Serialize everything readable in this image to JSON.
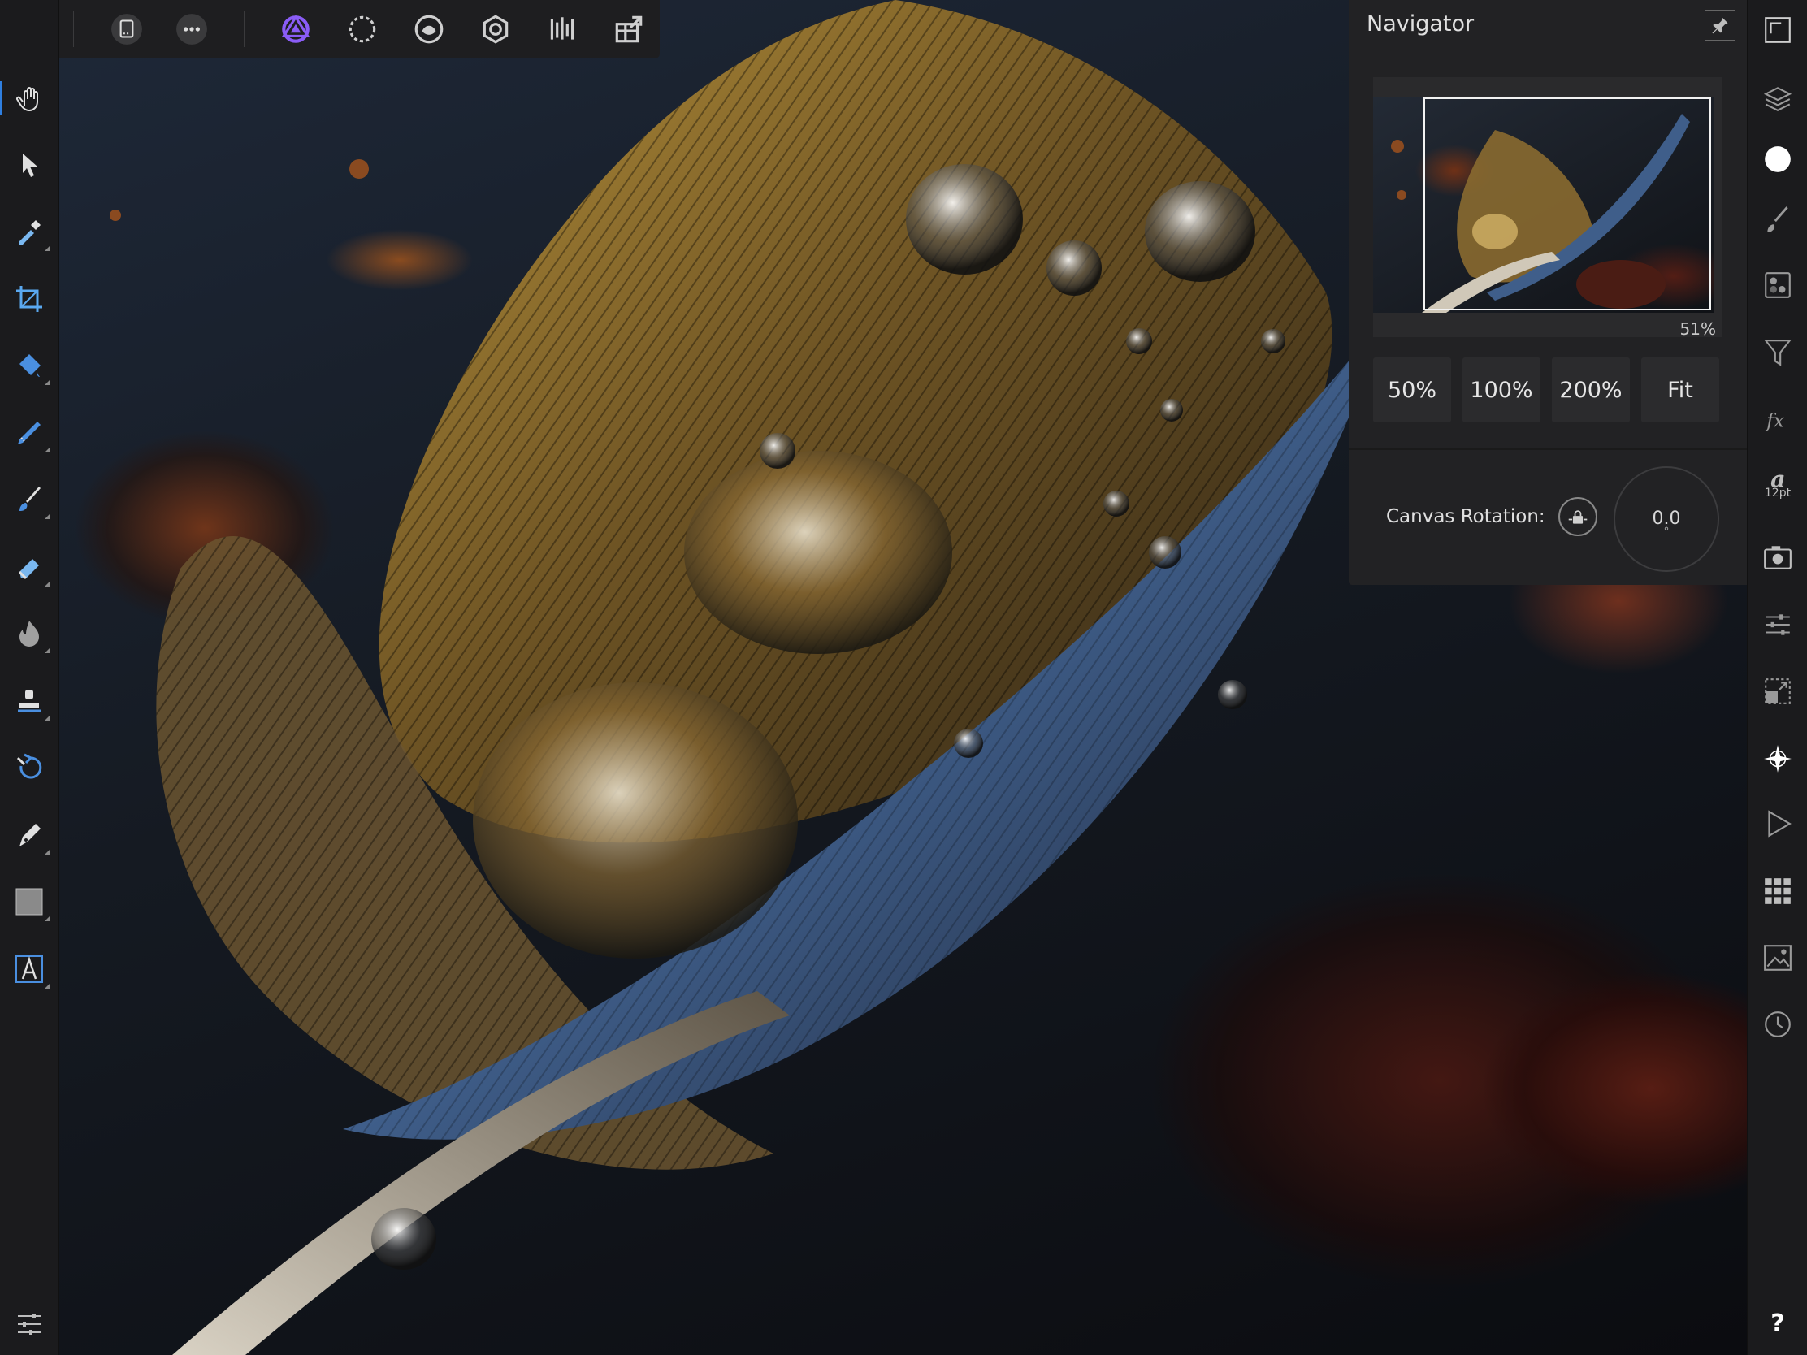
{
  "toolbar_top": {
    "buttons": [
      {
        "name": "back-icon"
      },
      {
        "name": "document-icon"
      },
      {
        "name": "more-icon"
      },
      {
        "name": "photo-persona-icon"
      },
      {
        "name": "selection-persona-icon"
      },
      {
        "name": "liquify-persona-icon"
      },
      {
        "name": "develop-persona-icon"
      },
      {
        "name": "tone-mapping-persona-icon"
      },
      {
        "name": "export-persona-icon"
      }
    ],
    "accent": "#8a5cf6"
  },
  "left_tools": [
    "view-tool",
    "move-tool",
    "color-picker-tool",
    "crop-tool",
    "flood-fill-tool",
    "selection-brush-tool",
    "paint-brush-tool",
    "erase-brush-tool",
    "dodge-tool",
    "clone-tool",
    "undo-brush-tool",
    "pen-tool",
    "shape-tool",
    "text-tool",
    "settings"
  ],
  "right_studio": {
    "items": [
      "fullscreen",
      "layers",
      "color",
      "brushes",
      "channels",
      "filters",
      "effects",
      "text-style",
      "snapshots",
      "adjustments",
      "transform",
      "navigator",
      "macro",
      "swatches",
      "stock",
      "history",
      "help"
    ],
    "text_style_size": "12pt",
    "help_label": "?"
  },
  "navigator": {
    "title": "Navigator",
    "zoom_percent": "51%",
    "zoom_buttons": [
      "50%",
      "100%",
      "200%",
      "Fit"
    ],
    "rotation_label": "Canvas Rotation:",
    "rotation_value": "0.0",
    "rotation_unit": "°"
  }
}
